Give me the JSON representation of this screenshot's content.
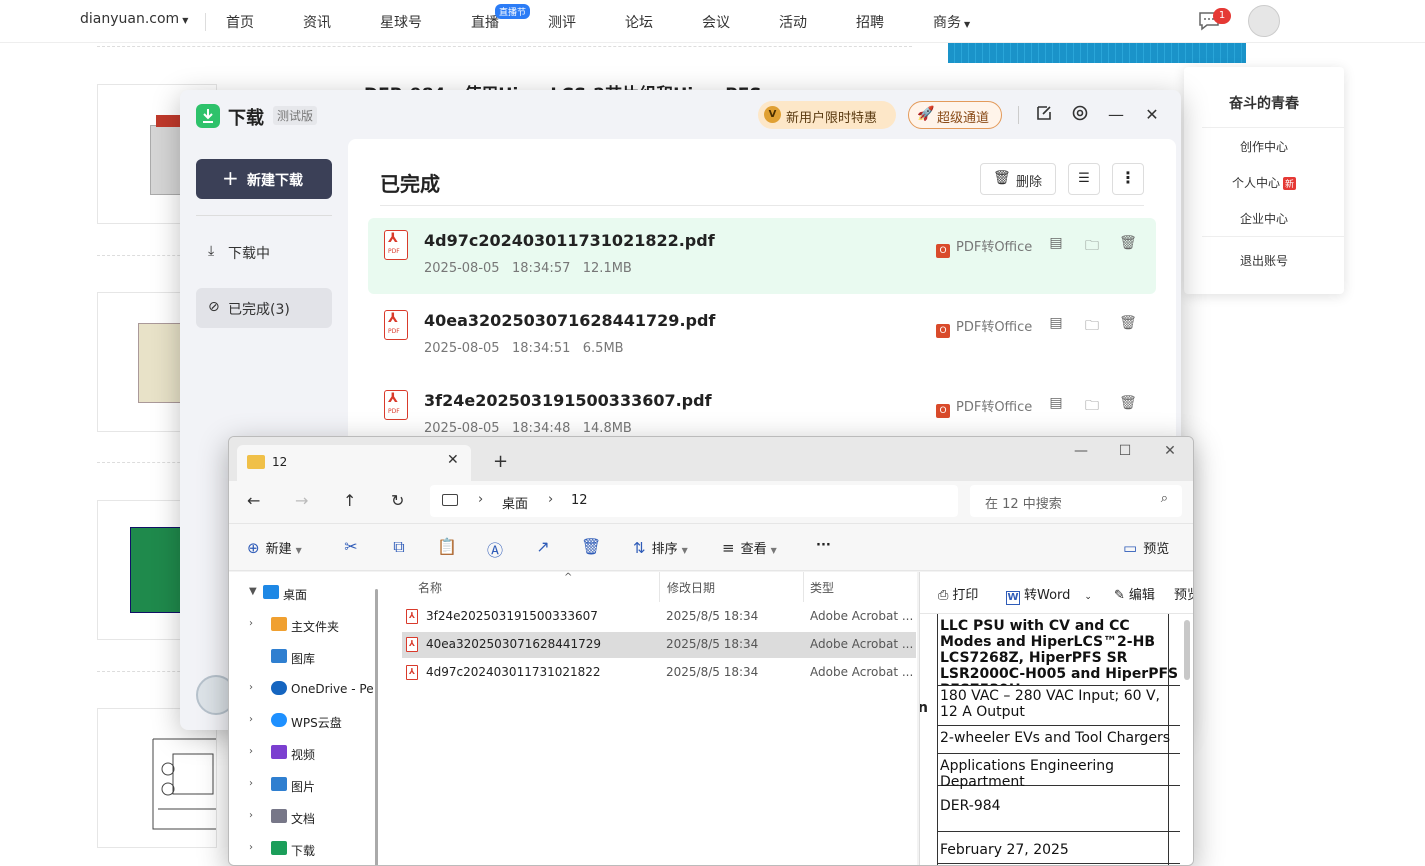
{
  "site": {
    "logo": "dianyuan.com",
    "nav": [
      "首页",
      "资讯",
      "星球号",
      "直播",
      "测评",
      "论坛",
      "会议",
      "活动",
      "招聘",
      "商务"
    ],
    "live_badge": "直播节",
    "msg_count": "1",
    "article_title": "DER-984 - 使用HiperLCS-2芯片组和HiperPFS",
    "user_menu": {
      "name": "奋斗的青春",
      "items": [
        "创作中心",
        "个人中心",
        "企业中心",
        "退出账号"
      ],
      "new_tag": "新"
    }
  },
  "download_manager": {
    "title": "下载",
    "beta": "测试版",
    "promo": "新用户限时特惠",
    "promo_icon": "V",
    "super_channel": "超级通道",
    "new_download": "新建下载",
    "sidebar": {
      "downloading": "下载中",
      "completed": "已完成(3)"
    },
    "heading": "已完成",
    "delete": "删除",
    "convert": "PDF转Office",
    "files": [
      {
        "name": "4d97c202403011731021822.pdf",
        "date": "2025-08-05",
        "time": "18:34:57",
        "size": "12.1MB"
      },
      {
        "name": "40ea3202503071628441729.pdf",
        "date": "2025-08-05",
        "time": "18:34:51",
        "size": "6.5MB"
      },
      {
        "name": "3f24e202503191500333607.pdf",
        "date": "2025-08-05",
        "time": "18:34:48",
        "size": "14.8MB"
      }
    ]
  },
  "explorer": {
    "tab_title": "12",
    "breadcrumb": [
      "桌面",
      "12"
    ],
    "search_placeholder": "在 12 中搜索",
    "commands": {
      "new": "新建",
      "sort": "排序",
      "view": "查看",
      "preview": "预览"
    },
    "tree": [
      {
        "label": "桌面",
        "color": "#1e88e5",
        "expanded": true
      },
      {
        "label": "主文件夹",
        "color": "#f0a030"
      },
      {
        "label": "图库",
        "color": "#2f7fd0"
      },
      {
        "label": "OneDrive - Pe",
        "color": "#1565c0"
      },
      {
        "label": "WPS云盘",
        "color": "#1e90ff"
      },
      {
        "label": "视频",
        "color": "#7b3fd0"
      },
      {
        "label": "图片",
        "color": "#2f7fd0"
      },
      {
        "label": "文档",
        "color": "#667"
      },
      {
        "label": "下载",
        "color": "#1b9e5a"
      }
    ],
    "columns": [
      "名称",
      "修改日期",
      "类型"
    ],
    "files": [
      {
        "name": "3f24e202503191500333607",
        "date": "2025/8/5 18:34",
        "type": "Adobe Acrobat ..."
      },
      {
        "name": "40ea3202503071628441729",
        "date": "2025/8/5 18:34",
        "type": "Adobe Acrobat ..."
      },
      {
        "name": "4d97c202403011731021822",
        "date": "2025/8/5 18:34",
        "type": "Adobe Acrobat ..."
      }
    ],
    "preview_toolbar": {
      "print": "打印",
      "to_word": "转Word",
      "edit": "编辑",
      "preview": "预览"
    },
    "preview_doc": {
      "title": "LLC PSU with CV and CC Modes and HiperLCS™2-HB LCS7268Z, HiperPFS SR LSR2000C-H005 and HiperPFS PFS7539H",
      "cells": [
        "180 VAC – 280 VAC Input; 60 V, 12 A Output",
        "2-wheeler EVs and Tool Chargers",
        "Applications Engineering Department",
        "DER-984",
        "February 27, 2025"
      ]
    }
  }
}
